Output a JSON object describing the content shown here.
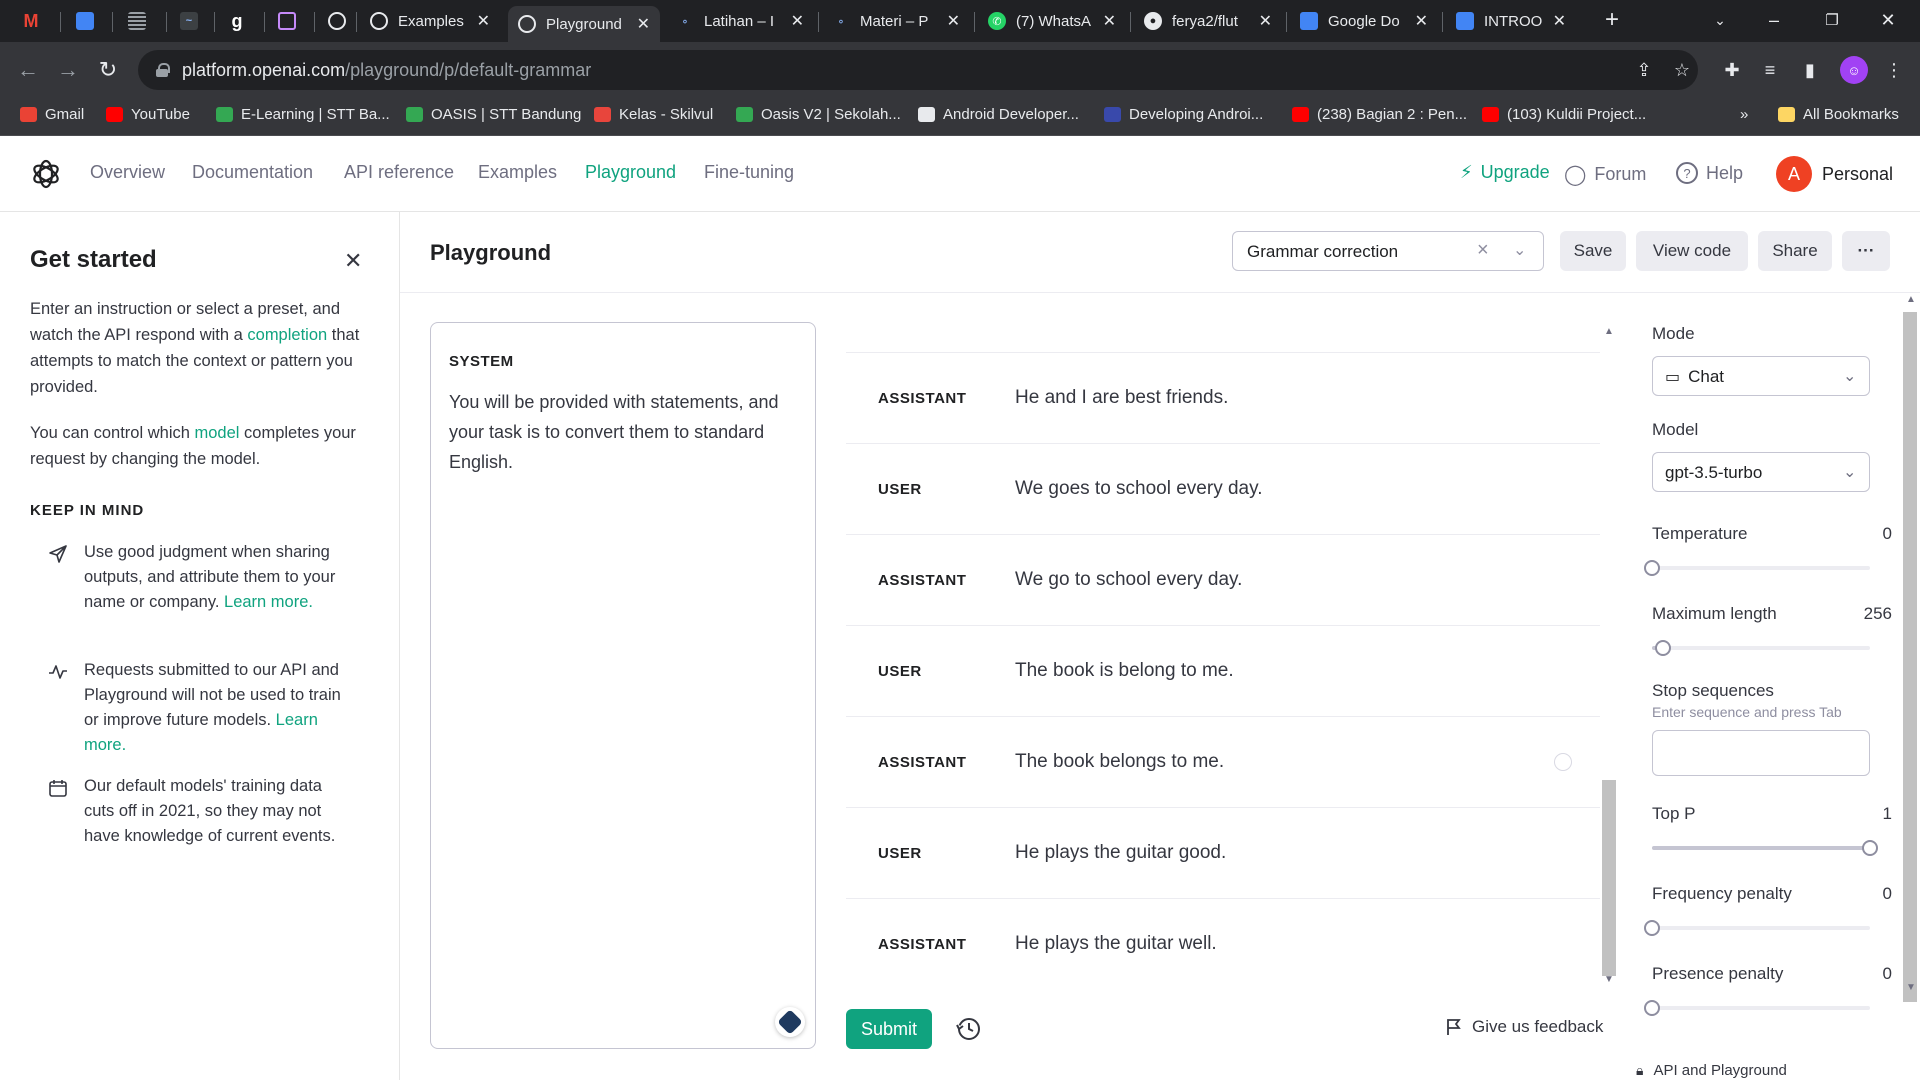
{
  "browser": {
    "tabs": [
      {
        "title": "",
        "favicon": "gmail",
        "color": "#ea4335"
      },
      {
        "title": "",
        "favicon": "docs-blue",
        "color": "#4285f4"
      },
      {
        "title": "",
        "favicon": "stripes",
        "color": "#5f6368"
      },
      {
        "title": "",
        "favicon": "chart-dark",
        "color": "#3c4043"
      },
      {
        "title": "",
        "favicon": "g-letter",
        "color": "#5f6368"
      },
      {
        "title": "",
        "favicon": "monitor-purple",
        "color": "#9334e6"
      },
      {
        "title": "",
        "favicon": "openai",
        "color": "#202124"
      },
      {
        "title": "Examples",
        "favicon": "openai",
        "color": "#202124"
      },
      {
        "title": "Playground",
        "favicon": "openai",
        "color": "#202124"
      },
      {
        "title": "Latihan – I",
        "favicon": "wp",
        "color": "#3c4043"
      },
      {
        "title": "Materi – P",
        "favicon": "wp",
        "color": "#3c4043"
      },
      {
        "title": "(7) WhatsA",
        "favicon": "whatsapp",
        "color": "#25d366"
      },
      {
        "title": "ferya2/flut",
        "favicon": "github",
        "color": "#202124"
      },
      {
        "title": "Google Do",
        "favicon": "gdocs",
        "color": "#4285f4"
      },
      {
        "title": "INTROOP",
        "favicon": "gdocs",
        "color": "#4285f4"
      }
    ],
    "url_host": "platform.openai.com",
    "url_path": "/playground/p/default-grammar",
    "bookmarks": [
      {
        "label": "Gmail",
        "color": "#ea4335"
      },
      {
        "label": "YouTube",
        "color": "#ff0000"
      },
      {
        "label": "E-Learning | STT Ba...",
        "color": "#34a853"
      },
      {
        "label": "OASIS | STT Bandung",
        "color": "#34a853"
      },
      {
        "label": "Kelas - Skilvul",
        "color": "#e8453c"
      },
      {
        "label": "Oasis V2 | Sekolah...",
        "color": "#34a853"
      },
      {
        "label": "Android Developer...",
        "color": "#202124"
      },
      {
        "label": "Developing Androi...",
        "color": "#3949ab"
      },
      {
        "label": "(238) Bagian 2 : Pen...",
        "color": "#ff0000"
      },
      {
        "label": "(103) Kuldii Project...",
        "color": "#ff0000"
      }
    ],
    "more_bookmarks": "»",
    "all_bookmarks": "All Bookmarks"
  },
  "header": {
    "nav": [
      "Overview",
      "Documentation",
      "API reference",
      "Examples",
      "Playground",
      "Fine-tuning"
    ],
    "active_nav": "Playground",
    "upgrade": "Upgrade",
    "forum": "Forum",
    "help": "Help",
    "avatar_letter": "A",
    "account": "Personal"
  },
  "sidebar": {
    "title": "Get started",
    "intro_before": "Enter an instruction or select a preset, and watch the API respond with a ",
    "intro_link": "completion",
    "intro_after": " that attempts to match the context or pattern you provided.",
    "model_before": "You can control which ",
    "model_link": "model",
    "model_after": " completes your request by changing the model.",
    "keep_in_mind": "KEEP IN MIND",
    "items": [
      {
        "icon": "send-icon",
        "text": "Use good judgment when sharing outputs, and attribute them to your name or company. ",
        "link": "Learn more."
      },
      {
        "icon": "activity-icon",
        "text": "Requests submitted to our API and Playground will not be used to train or improve future models. ",
        "link": "Learn more."
      },
      {
        "icon": "calendar-icon",
        "text": "Our default models' training data cuts off in 2021, so they may not have knowledge of current events.",
        "link": ""
      }
    ]
  },
  "main": {
    "title": "Playground",
    "preset_value": "Grammar correction",
    "save": "Save",
    "view_code": "View code",
    "share": "Share",
    "more": "···",
    "system_label": "SYSTEM",
    "system_text": "You will be provided with statements, and your task is to convert them to standard English.",
    "messages": [
      {
        "role": "ASSISTANT",
        "content": "He and I are best friends."
      },
      {
        "role": "USER",
        "content": "We goes to school every day."
      },
      {
        "role": "ASSISTANT",
        "content": "We go to school every day."
      },
      {
        "role": "USER",
        "content": "The book is belong to me."
      },
      {
        "role": "ASSISTANT",
        "content": "The book belongs to me."
      },
      {
        "role": "USER",
        "content": "He plays the guitar good."
      },
      {
        "role": "ASSISTANT",
        "content": "He plays the guitar well."
      }
    ],
    "submit": "Submit",
    "feedback": "Give us feedback"
  },
  "settings": {
    "mode_label": "Mode",
    "mode_value": "Chat",
    "model_label": "Model",
    "model_value": "gpt-3.5-turbo",
    "temperature_label": "Temperature",
    "temperature_value": "0",
    "temperature_fraction": 0,
    "max_length_label": "Maximum length",
    "max_length_value": "256",
    "max_length_fraction": 0.05,
    "stop_label": "Stop sequences",
    "stop_hint": "Enter sequence and press Tab",
    "top_p_label": "Top P",
    "top_p_value": "1",
    "top_p_fraction": 1,
    "freq_label": "Frequency penalty",
    "freq_value": "0",
    "freq_fraction": 0,
    "presence_label": "Presence penalty",
    "presence_value": "0",
    "presence_fraction": 0,
    "privacy": "API and Playground"
  }
}
